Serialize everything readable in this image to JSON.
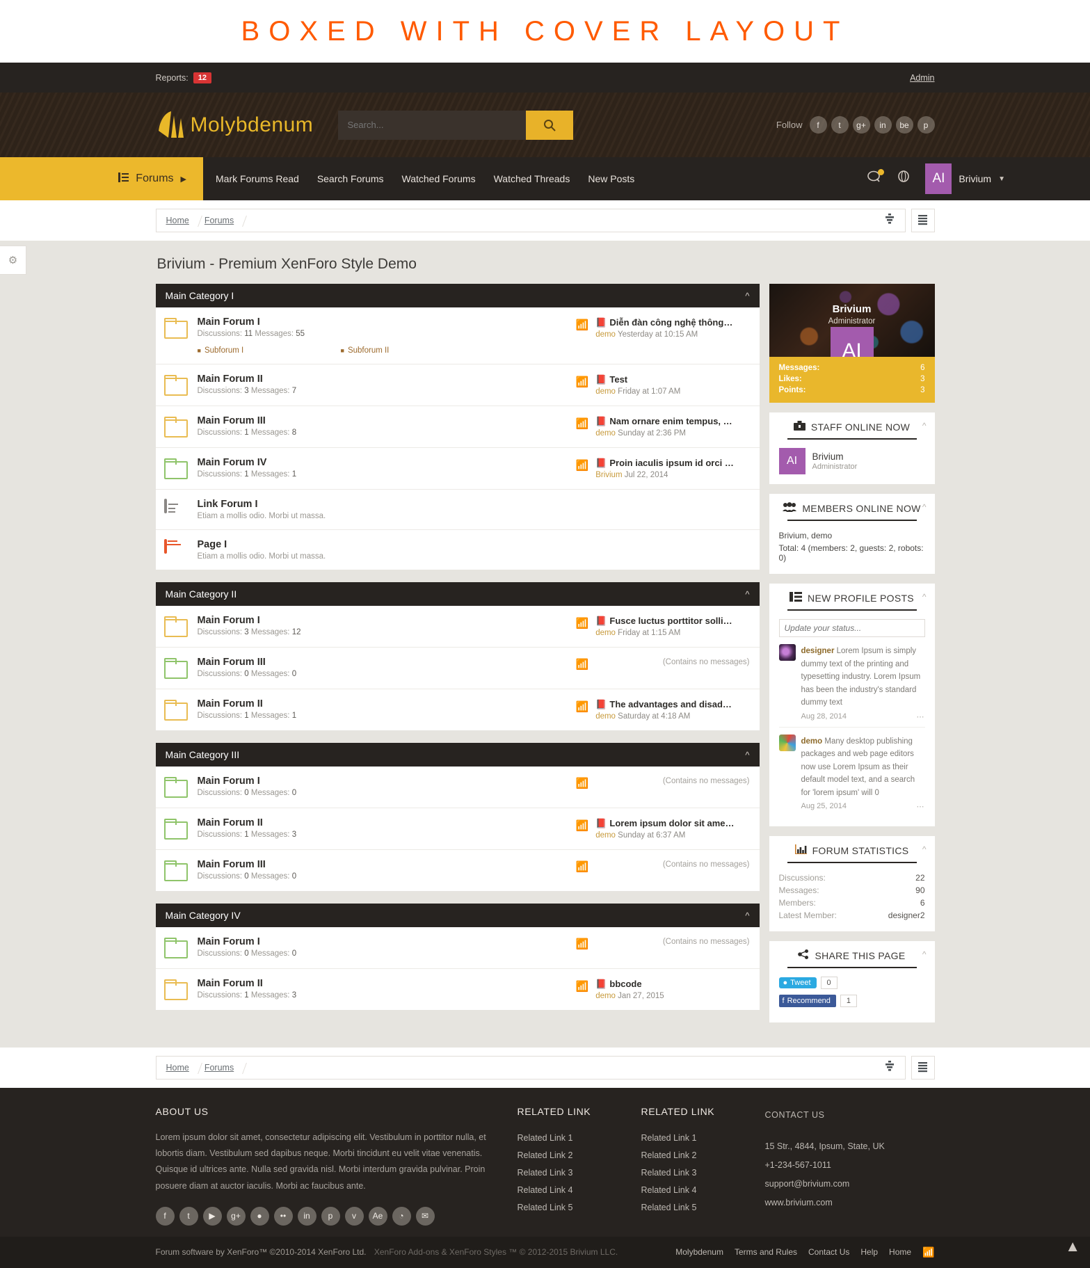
{
  "banner": {
    "title": "BOXED WITH COVER LAYOUT"
  },
  "topbar": {
    "reports_label": "Reports:",
    "reports_count": "12",
    "admin_label": "Admin"
  },
  "header": {
    "logo_text": "Molybdenum",
    "search_placeholder": "Search...",
    "search_value": "",
    "follow_label": "Follow",
    "social": [
      "f",
      "t",
      "g+",
      "in",
      "be",
      "p"
    ]
  },
  "nav": {
    "active_tab": "Forums",
    "links": [
      "Mark Forums Read",
      "Search Forums",
      "Watched Forums",
      "Watched Threads",
      "New Posts"
    ],
    "user_initials": "AI",
    "user_name": "Brivium"
  },
  "breadcrumb": {
    "items": [
      "Home",
      "Forums"
    ]
  },
  "main": {
    "page_title": "Brivium - Premium XenForo Style Demo",
    "no_messages_text": "(Contains no messages)",
    "categories": [
      {
        "title": "Main Category I",
        "forums": [
          {
            "icon": "folder-yellow",
            "title": "Main Forum I",
            "meta_discussions_label": "Discussions:",
            "meta_discussions": "11",
            "meta_messages_label": "Messages:",
            "meta_messages": "55",
            "subforums": [
              "Subforum I",
              "Subforum II"
            ],
            "last_title": "Diễn đàn công nghệ thông tin",
            "last_user": "demo",
            "last_date": "Yesterday at 10:15 AM"
          },
          {
            "icon": "folder-yellow",
            "title": "Main Forum II",
            "meta_discussions_label": "Discussions:",
            "meta_discussions": "3",
            "meta_messages_label": "Messages:",
            "meta_messages": "7",
            "subforums": [],
            "last_title": "Test",
            "last_user": "demo",
            "last_date": "Friday at 1:07 AM"
          },
          {
            "icon": "folder-yellow",
            "title": "Main Forum III",
            "meta_discussions_label": "Discussions:",
            "meta_discussions": "1",
            "meta_messages_label": "Messages:",
            "meta_messages": "8",
            "subforums": [],
            "last_title": "Nam ornare enim tempus, co...",
            "last_user": "demo",
            "last_date": "Sunday at 2:36 PM"
          },
          {
            "icon": "folder-green",
            "title": "Main Forum IV",
            "meta_discussions_label": "Discussions:",
            "meta_discussions": "1",
            "meta_messages_label": "Messages:",
            "meta_messages": "1",
            "subforums": [],
            "last_title": "Proin iaculis ipsum id orci adi...",
            "last_user": "Brivium",
            "last_date": "Jul 22, 2014"
          },
          {
            "icon": "link",
            "title": "Link Forum I",
            "desc": "Etiam a mollis odio. Morbi ut massa.",
            "subforums": []
          },
          {
            "icon": "page",
            "title": "Page I",
            "desc": "Etiam a mollis odio. Morbi ut massa.",
            "subforums": []
          }
        ]
      },
      {
        "title": "Main Category II",
        "forums": [
          {
            "icon": "folder-yellow",
            "title": "Main Forum I",
            "meta_discussions_label": "Discussions:",
            "meta_discussions": "3",
            "meta_messages_label": "Messages:",
            "meta_messages": "12",
            "subforums": [],
            "last_title": "Fusce luctus porttitor sollicit...",
            "last_user": "demo",
            "last_date": "Friday at 1:15 AM"
          },
          {
            "icon": "folder-green",
            "title": "Main Forum III",
            "meta_discussions_label": "Discussions:",
            "meta_discussions": "0",
            "meta_messages_label": "Messages:",
            "meta_messages": "0",
            "subforums": [],
            "empty": true
          },
          {
            "icon": "folder-yellow",
            "title": "Main Forum II",
            "meta_discussions_label": "Discussions:",
            "meta_discussions": "1",
            "meta_messages_label": "Messages:",
            "meta_messages": "1",
            "subforums": [],
            "last_title": "The advantages and disadva...",
            "last_user": "demo",
            "last_date": "Saturday at 4:18 AM"
          }
        ]
      },
      {
        "title": "Main Category III",
        "forums": [
          {
            "icon": "folder-green",
            "title": "Main Forum I",
            "meta_discussions_label": "Discussions:",
            "meta_discussions": "0",
            "meta_messages_label": "Messages:",
            "meta_messages": "0",
            "subforums": [],
            "empty": true
          },
          {
            "icon": "folder-green",
            "title": "Main Forum II",
            "meta_discussions_label": "Discussions:",
            "meta_discussions": "1",
            "meta_messages_label": "Messages:",
            "meta_messages": "3",
            "subforums": [],
            "last_title": "Lorem ipsum dolor sit amet, ...",
            "last_user": "demo",
            "last_date": "Sunday at 6:37 AM"
          },
          {
            "icon": "folder-green",
            "title": "Main Forum III",
            "meta_discussions_label": "Discussions:",
            "meta_discussions": "0",
            "meta_messages_label": "Messages:",
            "meta_messages": "0",
            "subforums": [],
            "empty": true
          }
        ]
      },
      {
        "title": "Main Category IV",
        "forums": [
          {
            "icon": "folder-green",
            "title": "Main Forum I",
            "meta_discussions_label": "Discussions:",
            "meta_discussions": "0",
            "meta_messages_label": "Messages:",
            "meta_messages": "0",
            "subforums": [],
            "empty": true
          },
          {
            "icon": "folder-yellow",
            "title": "Main Forum II",
            "meta_discussions_label": "Discussions:",
            "meta_discussions": "1",
            "meta_messages_label": "Messages:",
            "meta_messages": "3",
            "subforums": [],
            "last_title": "bbcode",
            "last_user": "demo",
            "last_date": "Jan 27, 2015"
          }
        ]
      }
    ]
  },
  "sidebar": {
    "visitor": {
      "name": "Brivium",
      "role": "Administrator",
      "initials": "AI",
      "stats": [
        {
          "label": "Messages:",
          "value": "6"
        },
        {
          "label": "Likes:",
          "value": "3"
        },
        {
          "label": "Points:",
          "value": "3"
        }
      ]
    },
    "staff_online": {
      "title": "STAFF ONLINE NOW",
      "members": [
        {
          "initials": "AI",
          "name": "Brivium",
          "role": "Administrator"
        }
      ]
    },
    "members_online": {
      "title": "MEMBERS ONLINE NOW",
      "names": "Brivium, demo",
      "total": "Total: 4 (members: 2, guests: 2, robots: 0)"
    },
    "profile_posts": {
      "title": "NEW PROFILE POSTS",
      "status_placeholder": "Update your status...",
      "posts": [
        {
          "user": "designer",
          "text": "Lorem Ipsum is simply dummy text of the printing and typesetting industry. Lorem Ipsum has been the industry's standard dummy text",
          "date": "Aug 28, 2014",
          "more": "…"
        },
        {
          "user": "demo",
          "text": "Many desktop publishing packages and web page editors now use Lorem Ipsum as their default model text, and a search for 'lorem ipsum' will 0",
          "date": "Aug 25, 2014",
          "more": "…"
        }
      ]
    },
    "forum_statistics": {
      "title": "FORUM STATISTICS",
      "rows": [
        {
          "label": "Discussions:",
          "value": "22"
        },
        {
          "label": "Messages:",
          "value": "90"
        },
        {
          "label": "Members:",
          "value": "6"
        },
        {
          "label": "Latest Member:",
          "value": "designer2"
        }
      ]
    },
    "share": {
      "title": "SHARE THIS PAGE",
      "tweet_label": "Tweet",
      "tweet_count": "0",
      "recommend_label": "Recommend",
      "recommend_count": "1"
    }
  },
  "footer": {
    "about_head": "ABOUT US",
    "about_text": "Lorem ipsum dolor sit amet, consectetur adipiscing elit. Vestibulum in porttitor nulla, et lobortis diam. Vestibulum sed dapibus neque. Morbi tincidunt eu velit vitae venenatis. Quisque id ultrices ante. Nulla sed gravida nisl. Morbi interdum gravida pulvinar. Proin posuere diam at auctor iaculis. Morbi ac faucibus ante.",
    "col1_head": "RELATED LINK",
    "col1_links": [
      "Related Link 1",
      "Related Link 2",
      "Related Link 3",
      "Related Link 4",
      "Related Link 5"
    ],
    "col2_head": "RELATED LINK",
    "col2_links": [
      "Related Link 1",
      "Related Link 2",
      "Related Link 3",
      "Related Link 4",
      "Related Link 5"
    ],
    "contact_head": "CONTACT US",
    "contact_lines": [
      "15 Str., 4844, Ipsum, State, UK",
      "+1-234-567-1011",
      "support@brivium.com",
      "www.brivium.com"
    ],
    "social": [
      "f",
      "t",
      "▶",
      "g+",
      "●",
      "••",
      "in",
      "p",
      "v",
      "Ae",
      "◔",
      "✉"
    ],
    "copyright_main": "Forum software by XenForo™ ©2010-2014 XenForo Ltd.",
    "copyright_sub": "XenForo Add-ons & XenForo Styles ™ © 2012-2015 Brivium LLC.",
    "links": [
      "Molybdenum",
      "Terms and Rules",
      "Contact Us",
      "Help",
      "Home"
    ]
  },
  "colors": {
    "accent": "#ecb82c",
    "dark": "#272320",
    "orange": "#ff5a00",
    "purple": "#a35bad"
  }
}
